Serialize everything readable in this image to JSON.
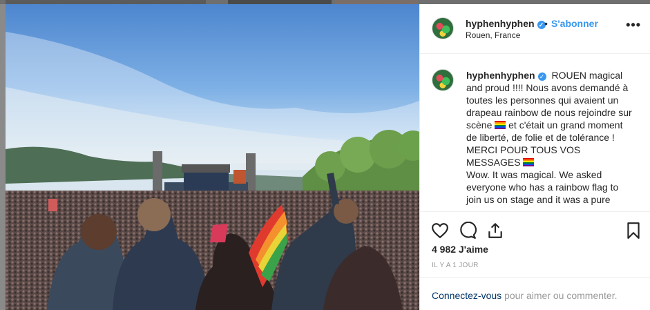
{
  "post": {
    "username": "hyphenhyphen",
    "verified_mark": "✓",
    "separator": "•",
    "follow_label": "S'abonner",
    "location": "Rouen, France",
    "more_icon": "more-options-icon",
    "caption_parts": {
      "text1": "ROUEN magical and proud !!!! Nous avons demandé à toutes les personnes qui avaient un drapeau rainbow de nous rejoindre sur scène",
      "text2": "et c'était un grand moment de liberté, de folie et de tolérance ! MERCI POUR TOUS VOS MESSAGES",
      "text3": "Wow. It was magical. We asked everyone who has a rainbow flag to join us on stage and it was a pure"
    },
    "likes": "4 982 J'aime",
    "timestamp": "IL Y A 1 JOUR"
  },
  "footer": {
    "login_link": "Connectez-vous",
    "login_rest": " pour aimer ou commenter."
  },
  "colors": {
    "accent": "#3897f0",
    "text": "#262626",
    "muted": "#999999",
    "link": "#003569"
  },
  "icons": [
    "heart-icon",
    "comment-icon",
    "share-icon",
    "bookmark-icon",
    "rainbow-flag-icon",
    "verified-badge-icon"
  ]
}
